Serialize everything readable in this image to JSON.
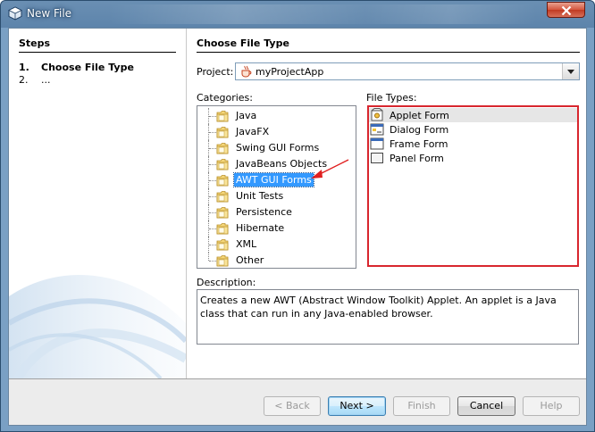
{
  "window": {
    "title": "New File"
  },
  "steps": {
    "title": "Steps",
    "items": [
      {
        "num": "1.",
        "label": "Choose File Type"
      },
      {
        "num": "2.",
        "label": "..."
      }
    ]
  },
  "main": {
    "title": "Choose File Type",
    "project_label": "Project:",
    "project_value": "myProjectApp",
    "categories_label": "Categories:",
    "categories": [
      "Java",
      "JavaFX",
      "Swing GUI Forms",
      "JavaBeans Objects",
      "AWT GUI Forms",
      "Unit Tests",
      "Persistence",
      "Hibernate",
      "XML",
      "Other"
    ],
    "selected_category": "AWT GUI Forms",
    "filetypes_label": "File Types:",
    "filetypes": [
      "Applet Form",
      "Dialog Form",
      "Frame Form",
      "Panel Form"
    ],
    "selected_filetype": "Applet Form",
    "description_label": "Description:",
    "description": "Creates a new AWT (Abstract Window Toolkit) Applet. An applet is a Java class that can run in any Java-enabled browser."
  },
  "buttons": {
    "back": "< Back",
    "next": "Next >",
    "finish": "Finish",
    "cancel": "Cancel",
    "help": "Help"
  },
  "colors": {
    "highlight_border": "#d8262e",
    "selection": "#3399ff",
    "arrow": "#e02020"
  }
}
